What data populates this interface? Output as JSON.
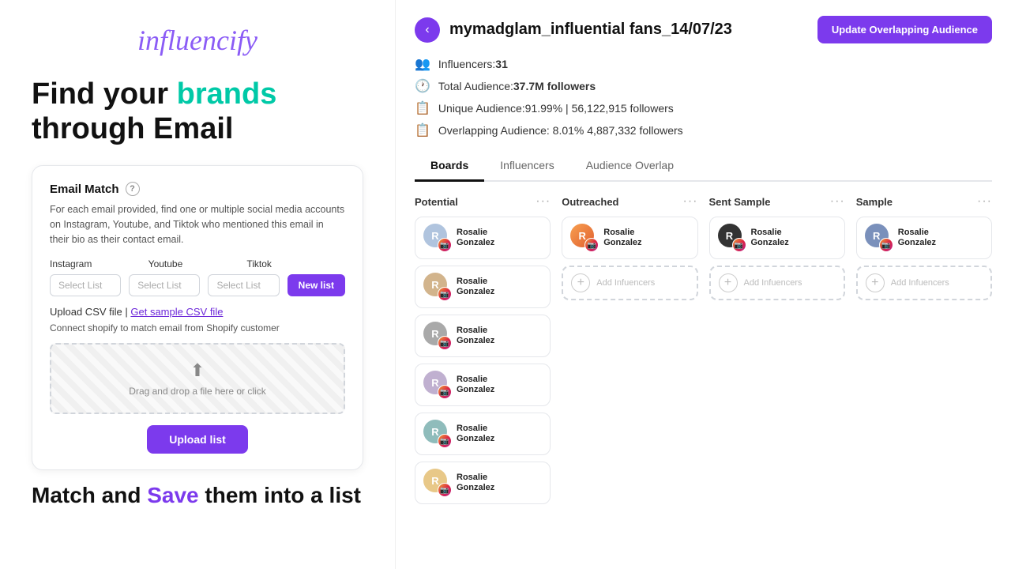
{
  "left": {
    "logo": "influencify",
    "headline_part1": "Find your ",
    "headline_highlight": "brands",
    "headline_part2": " through Email",
    "card": {
      "title": "Email Match",
      "description": "For each email provided, find one or multiple social media accounts on Instagram, Youtube, and Tiktok who mentioned this email in their bio as their contact email.",
      "labels": {
        "instagram": "Instagram",
        "youtube": "Youtube",
        "tiktok": "Tiktok"
      },
      "placeholders": {
        "instagram": "Select List",
        "youtube": "Select List",
        "tiktok": "Select List"
      },
      "new_list_btn": "New list",
      "upload_csv_label": "Upload CSV file |",
      "sample_csv_label": "Get sample CSV file",
      "shopify_label": "Connect shopify to match email from Shopify customer",
      "upload_zone_text": "Drag and drop a file here or click",
      "upload_btn": "Upload list"
    },
    "tagline_part1": "Match and ",
    "tagline_highlight": "Save",
    "tagline_part2": " them into a list"
  },
  "right": {
    "back_icon": "‹",
    "page_title": "mymadglam_influential fans_14/07/23",
    "update_btn": "Update Overlapping Audience",
    "stats": [
      {
        "icon": "👥",
        "label": "Influencers:31",
        "bold": false
      },
      {
        "icon": "🕐",
        "label": "Total Audience:",
        "bold_part": "37.7M followers"
      },
      {
        "icon": "📋",
        "label": "Unique Audience:91.99% | 56,122,915 followers"
      },
      {
        "icon": "📋",
        "label": "Overlapping Audience: 8.01%  4,887,332 followers"
      }
    ],
    "tabs": [
      {
        "label": "Boards",
        "active": true
      },
      {
        "label": "Influencers",
        "active": false
      },
      {
        "label": "Audience Overlap",
        "active": false
      }
    ],
    "boards": [
      {
        "title": "Potential",
        "influencers": [
          {
            "name": "Rosalie Gonzalez",
            "av": "av1"
          },
          {
            "name": "Rosalie Gonzalez",
            "av": "av2"
          },
          {
            "name": "Rosalie Gonzalez",
            "av": "av3"
          },
          {
            "name": "Rosalie Gonzalez",
            "av": "av4"
          },
          {
            "name": "Rosalie Gonzalez",
            "av": "av5"
          },
          {
            "name": "Rosalie Gonzalez",
            "av": "av6"
          }
        ],
        "add_label": ""
      },
      {
        "title": "Outreached",
        "influencers": [
          {
            "name": "Rosalie Gonzalez",
            "av": "av-orange"
          }
        ],
        "add_label": "Add Infuencers"
      },
      {
        "title": "Sent Sample",
        "influencers": [
          {
            "name": "Rosalie Gonzalez",
            "av": "av-dark"
          }
        ],
        "add_label": "Add Infuencers"
      },
      {
        "title": "Sample",
        "influencers": [
          {
            "name": "Rosalie Gonzalez",
            "av": "av-blue"
          }
        ],
        "add_label": "Add Infuencers"
      }
    ]
  }
}
